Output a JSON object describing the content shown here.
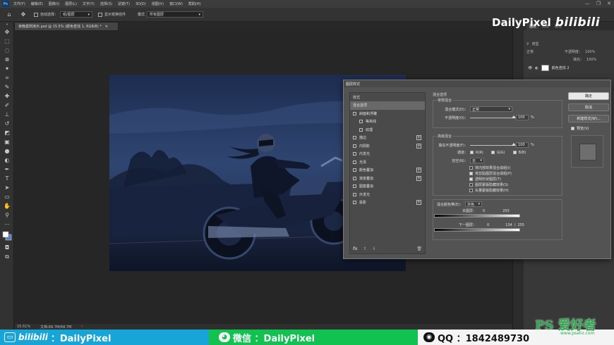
{
  "menubar": {
    "logo": "Ps",
    "items": [
      "文件(F)",
      "编辑(E)",
      "图像(I)",
      "图层(L)",
      "文字(Y)",
      "选择(S)",
      "滤镜(T)",
      "3D(D)",
      "视图(V)",
      "窗口(W)",
      "帮助(H)"
    ],
    "min": "—",
    "max": "❐",
    "close": "✕"
  },
  "options": {
    "auto_select_label": "自动选择：",
    "auto_select_value": "组/图层",
    "show_transform_label": "显示变换控件",
    "mode_label": "模式",
    "mode_value": "所有图层"
  },
  "document": {
    "tab_title": "夜晚案例演示.psd @ 15.5% (颜色查找 1, RGB/8) *",
    "close": "✕"
  },
  "status": {
    "zoom": "15.51%",
    "doc_size": "文档:68.7M/68.7M",
    "arrow": "›"
  },
  "watermark": {
    "title": "DailyPixel",
    "bili": "bilibili"
  },
  "panel": {
    "tabs": [
      "图层",
      "通道",
      "路径"
    ],
    "search_label": "类型",
    "mode_label": "正常",
    "opacity_label": "不透明度：",
    "opacity_value": "100%",
    "fill_label": "填充：",
    "fill_value": "100%",
    "layer_name": "颜色查找 2"
  },
  "dialog": {
    "title": "图层样式",
    "styles_header": "样式",
    "styles": [
      {
        "label": "混合选项",
        "selected": true,
        "checkbox": false,
        "plus": false,
        "sub": false
      },
      {
        "label": "斜面和浮雕",
        "selected": false,
        "checkbox": true,
        "plus": false,
        "sub": false
      },
      {
        "label": "等高线",
        "selected": false,
        "checkbox": true,
        "plus": false,
        "sub": true
      },
      {
        "label": "纹理",
        "selected": false,
        "checkbox": true,
        "plus": false,
        "sub": true
      },
      {
        "label": "描边",
        "selected": false,
        "checkbox": true,
        "plus": true,
        "sub": false
      },
      {
        "label": "内阴影",
        "selected": false,
        "checkbox": true,
        "plus": true,
        "sub": false
      },
      {
        "label": "内发光",
        "selected": false,
        "checkbox": true,
        "plus": false,
        "sub": false
      },
      {
        "label": "光泽",
        "selected": false,
        "checkbox": true,
        "plus": false,
        "sub": false
      },
      {
        "label": "颜色叠加",
        "selected": false,
        "checkbox": true,
        "plus": true,
        "sub": false
      },
      {
        "label": "渐变叠加",
        "selected": false,
        "checkbox": true,
        "plus": true,
        "sub": false
      },
      {
        "label": "图案叠加",
        "selected": false,
        "checkbox": true,
        "plus": false,
        "sub": false
      },
      {
        "label": "外发光",
        "selected": false,
        "checkbox": true,
        "plus": false,
        "sub": false
      },
      {
        "label": "投影",
        "selected": false,
        "checkbox": true,
        "plus": true,
        "sub": false
      }
    ],
    "footer_fx": "fx",
    "blend": {
      "section": "混合选项",
      "general_label": "常规混合",
      "blend_mode_label": "混合模式(D)：",
      "blend_mode_value": "正常",
      "opacity_label": "不透明度(O)：",
      "opacity_value": "100",
      "opacity_pct": 1.0,
      "advanced_label": "高级混合",
      "fill_label": "填充不透明度(F)：",
      "fill_value": "100",
      "fill_pct": 1.0,
      "channels_label": "通道：",
      "ch_r": "R(R)",
      "ch_g": "G(G)",
      "ch_b": "B(B)",
      "knockout_label": "挖空(N)：",
      "knockout_value": "无",
      "opt1": "将内部效果混合成组(I)",
      "opt2": "将剪贴图层混合成组(P)",
      "opt3": "透明形状图层(T)",
      "opt4": "图层蒙版隐藏效果(S)",
      "opt5": "矢量蒙版隐藏效果(H)",
      "blend_if_label": "混合颜色带(E)：",
      "blend_if_value": "灰色",
      "this_layer_label": "本图层：",
      "this_min": "0",
      "this_max": "255",
      "under_label": "下一图层：",
      "under_min": "0",
      "under_mid": "134",
      "under_slash": "/",
      "under_max": "255",
      "percent": "%"
    },
    "buttons": {
      "ok": "确定",
      "cancel": "取消",
      "new_style": "新建样式(W)...",
      "preview": "预览(V)"
    }
  },
  "banner": {
    "bili_text": "：DailyPixel",
    "bili_logo": "bilibili",
    "wechat_text": "微信 ：DailyPixel",
    "qq_text": "QQ ：1842489730"
  },
  "site_wm": {
    "brand": "PS 爱好者",
    "url": "www.psahz.com"
  },
  "colors": {
    "bili_blue": "#17a4d6",
    "wechat_green": "#11c251",
    "ps_green": "#2fa84f"
  }
}
